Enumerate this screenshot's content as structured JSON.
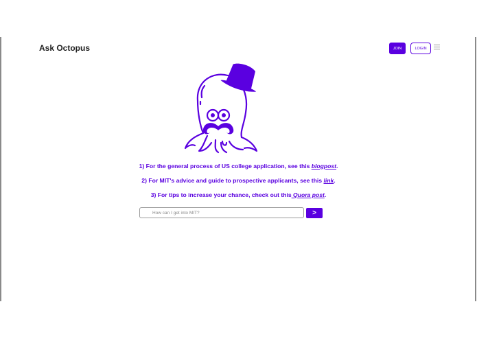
{
  "header": {
    "brand": "Ask Octopus",
    "join_label": "JOIN",
    "login_label": "LOGIN",
    "menu_icon": "hamburger-menu-icon"
  },
  "colors": {
    "accent": "#5a00e0",
    "text_dark": "#222222",
    "border_gray": "#9a9a9a"
  },
  "mascot": {
    "icon": "octopus-top-hat-mustache-icon"
  },
  "resources": [
    {
      "prefix": "1) For the general process of US college application, see this ",
      "link": "blogpost",
      "suffix": "."
    },
    {
      "prefix": "2) For MIT's advice and guide to prospective applicants, see this ",
      "link": "link",
      "suffix": "."
    },
    {
      "prefix": "3) For tips to increase your chance, check out this",
      "link": " Quora post",
      "suffix": "."
    }
  ],
  "search": {
    "placeholder": "How can I get into MIT?",
    "value": "",
    "submit_label": ">"
  }
}
